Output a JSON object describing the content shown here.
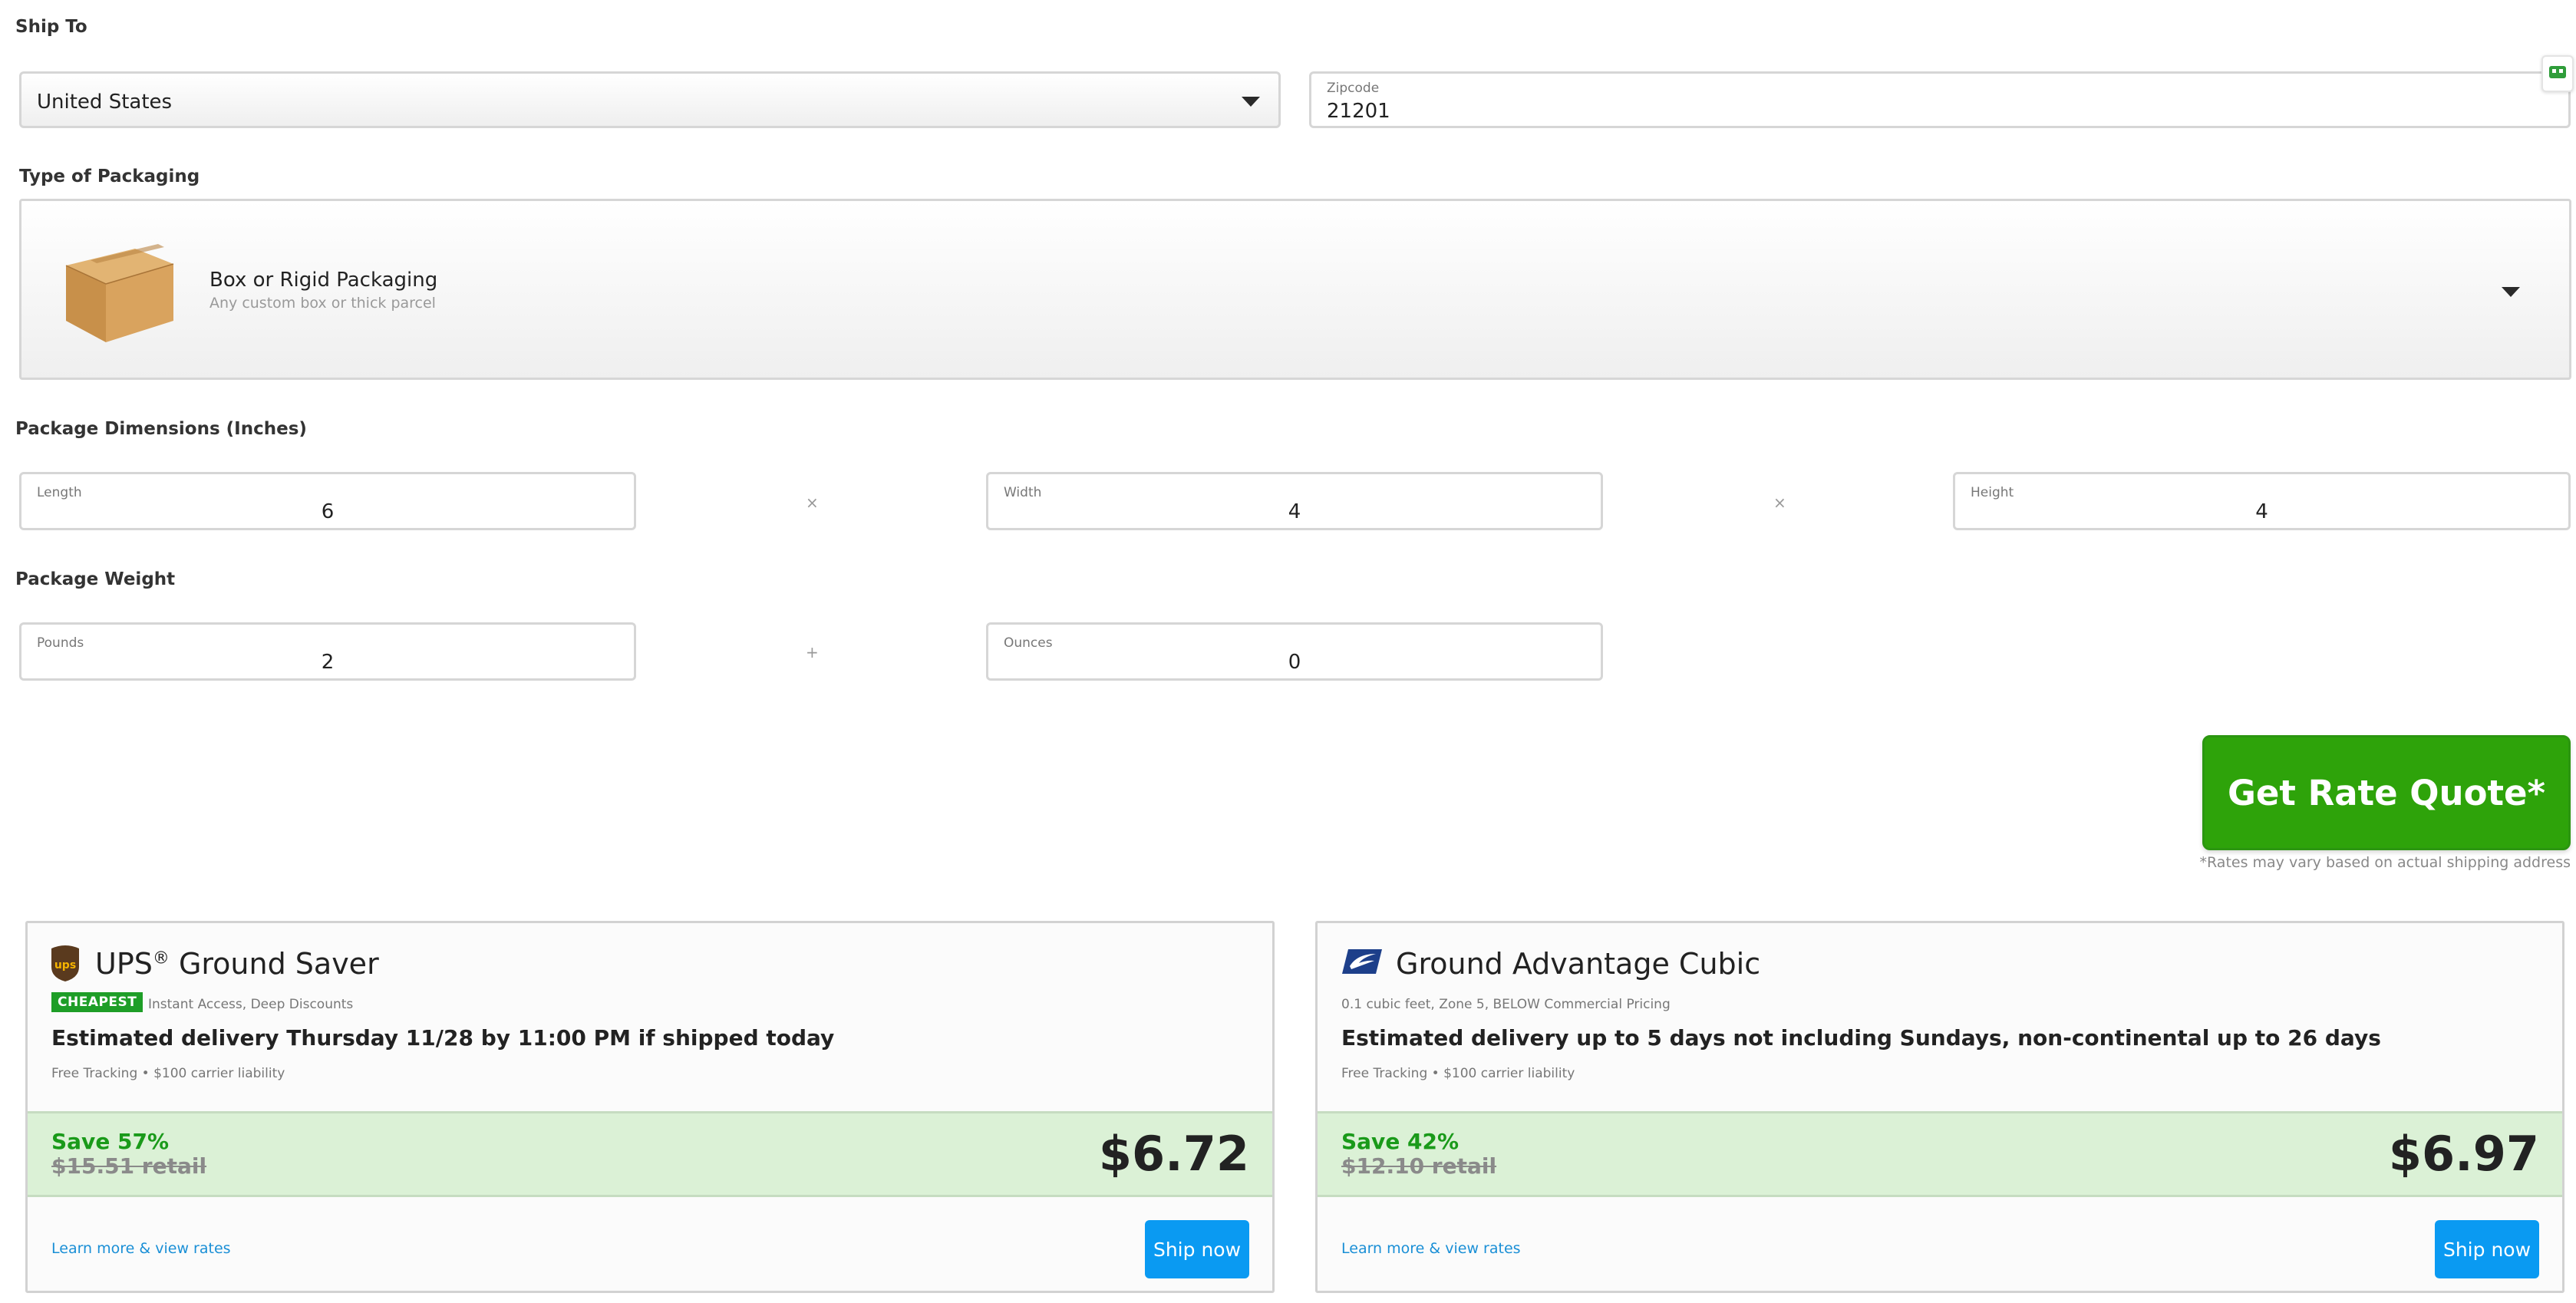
{
  "ship_to": {
    "section_label": "Ship To",
    "country_value": "United States",
    "zipcode_label": "Zipcode",
    "zipcode_value": "21201"
  },
  "packaging": {
    "section_label": "Type of Packaging",
    "title": "Box or Rigid Packaging",
    "subtitle": "Any custom box or thick parcel"
  },
  "dimensions": {
    "section_label": "Package Dimensions (Inches)",
    "length_label": "Length",
    "length_value": "6",
    "width_label": "Width",
    "width_value": "4",
    "height_label": "Height",
    "height_value": "4",
    "separator": "×"
  },
  "weight": {
    "section_label": "Package Weight",
    "pounds_label": "Pounds",
    "pounds_value": "2",
    "ounces_label": "Ounces",
    "ounces_value": "0",
    "separator": "+"
  },
  "quote": {
    "button_label": "Get Rate Quote*",
    "disclaimer": "*Rates may vary based on actual shipping address"
  },
  "rates": [
    {
      "carrier_icon": "ups-logo-icon",
      "title": "UPS",
      "title_sup": "®",
      "title_rest": " Ground Saver",
      "badge": "CHEAPEST",
      "note": "Instant Access, Deep Discounts",
      "delivery": "Estimated delivery Thursday 11/28 by 11:00 PM if shipped today",
      "features": "Free Tracking • $100 carrier liability",
      "save": "Save 57%",
      "retail": "$15.51 retail",
      "price": "$6.72",
      "learn_link": "Learn more & view rates",
      "ship_button": "Ship now",
      "colors": {
        "logo_bg": "#5a3a1e",
        "logo_text": "#f5b400"
      }
    },
    {
      "carrier_icon": "usps-eagle-icon",
      "title": "Ground Advantage Cubic",
      "badge": "",
      "note": "0.1 cubic feet, Zone 5, BELOW Commercial Pricing",
      "delivery": "Estimated delivery up to 5 days not including Sundays, non-continental up to 26 days",
      "features": "Free Tracking • $100 carrier liability",
      "save": "Save 42%",
      "retail": "$12.10 retail",
      "price": "$6.97",
      "learn_link": "Learn more & view rates",
      "ship_button": "Ship now",
      "colors": {
        "logo_bg": "#1d3f8a"
      }
    }
  ],
  "colors": {
    "quote_button": "#2ea30a",
    "ship_button": "#0a9af2",
    "price_band": "#dbf1d6",
    "save_text": "#1a9a1a",
    "link": "#1a8fd6"
  }
}
